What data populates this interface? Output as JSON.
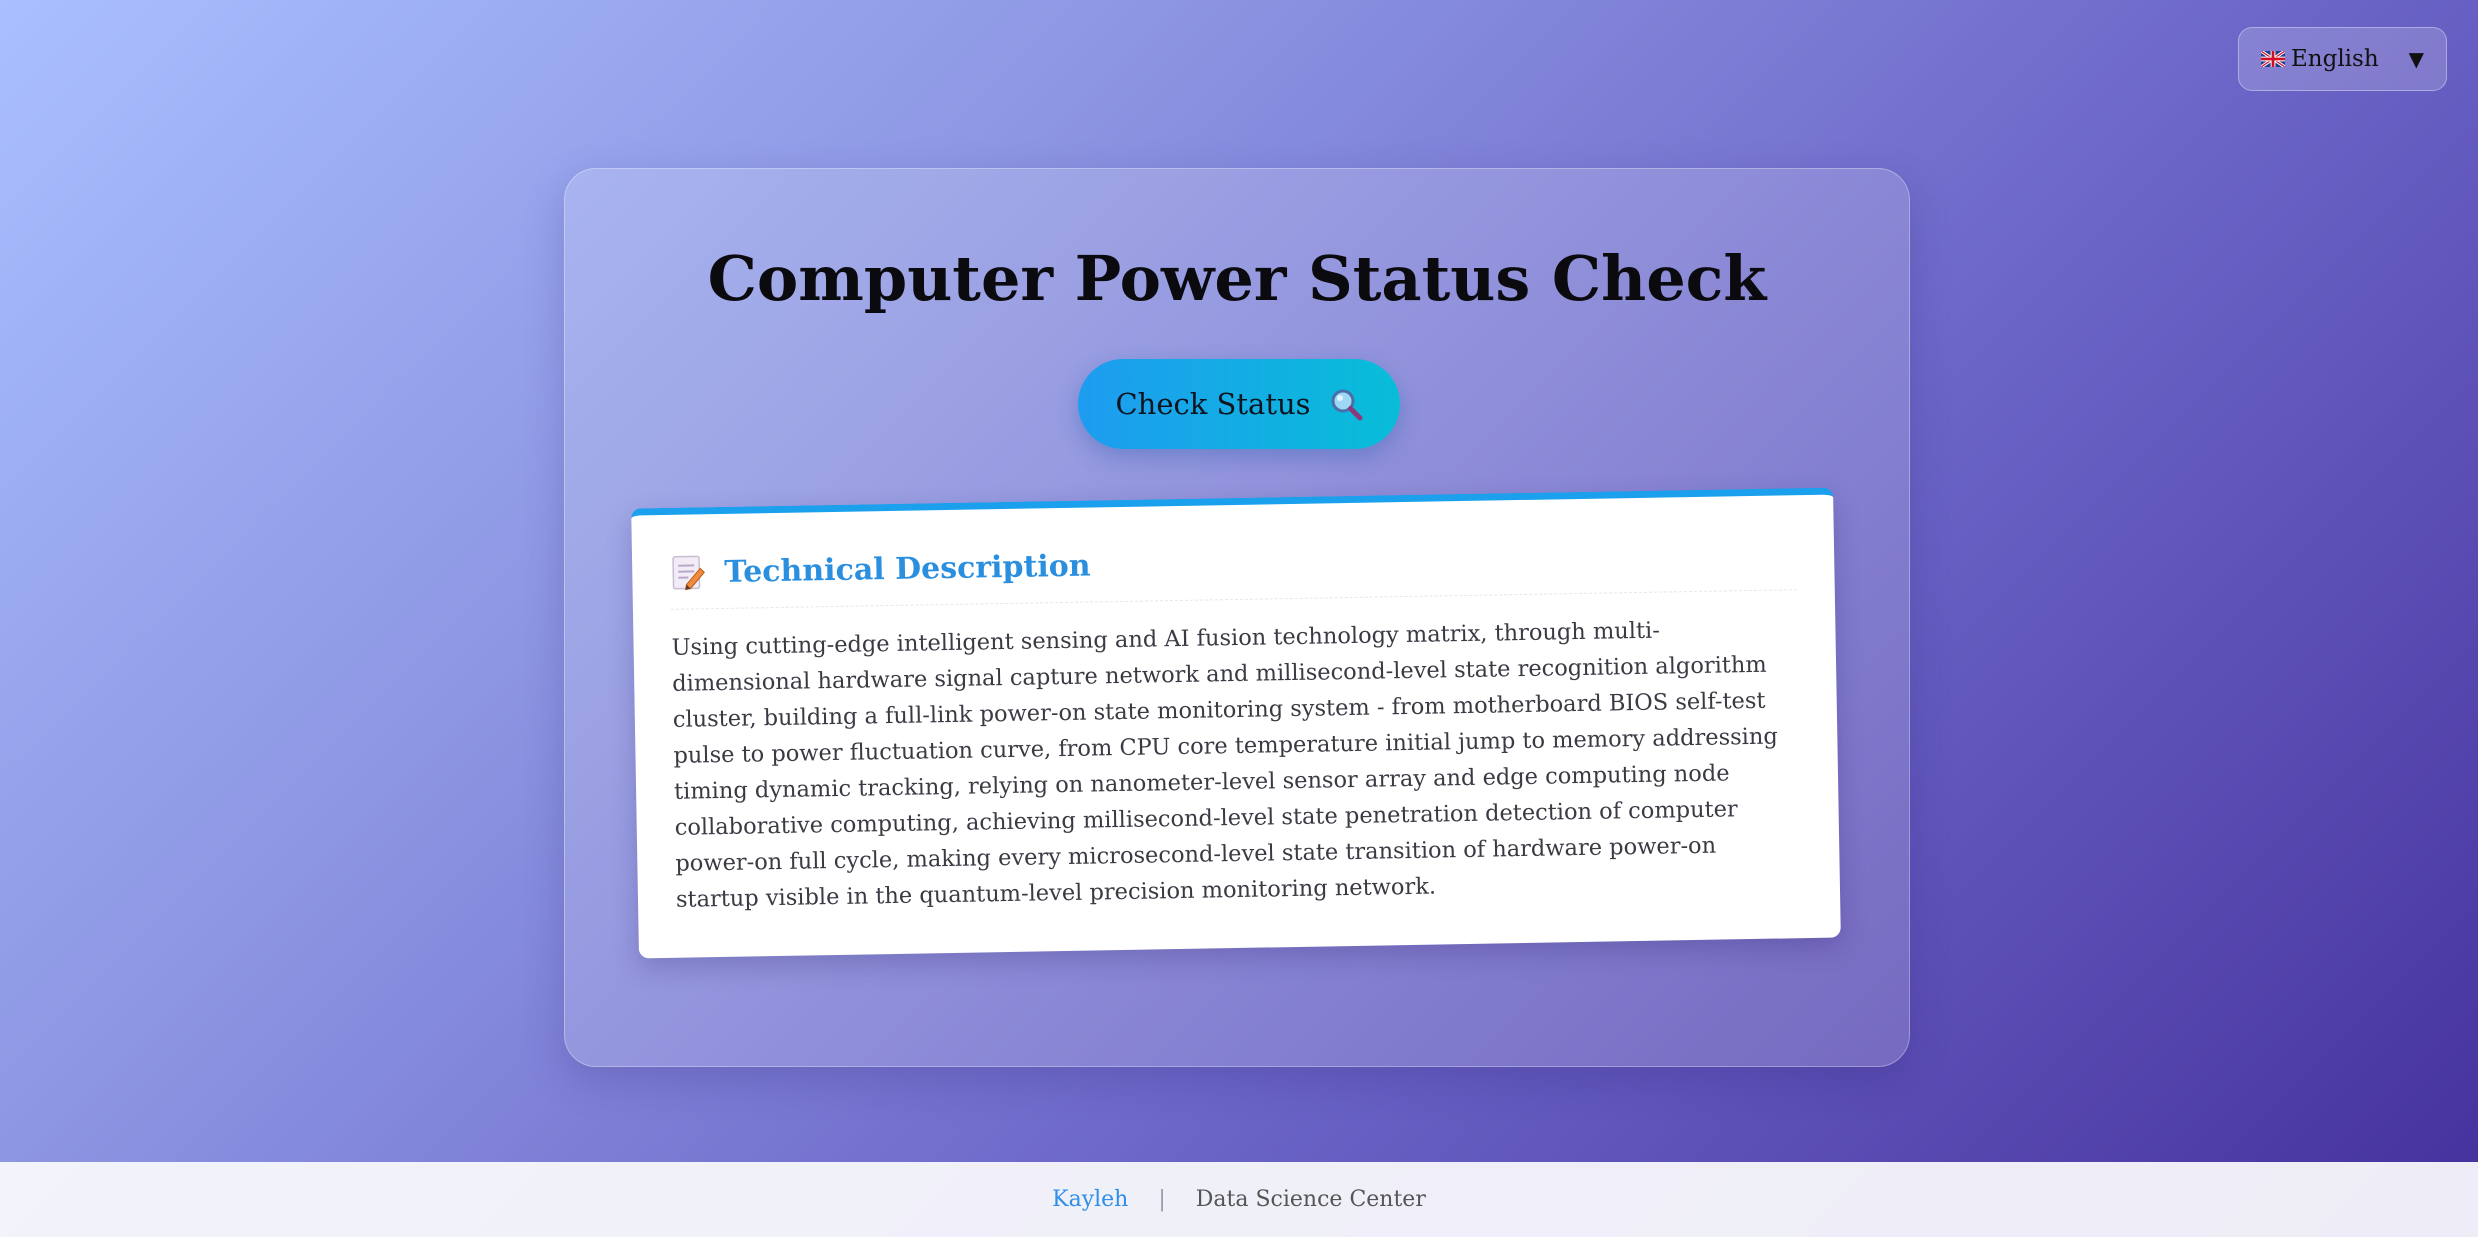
{
  "language_selector": {
    "label": "English",
    "flag": "uk-flag-icon",
    "chevron": "▼"
  },
  "main": {
    "title": "Computer Power Status Check",
    "check_button_label": "Check Status",
    "check_button_icon": "magnifying-glass-icon"
  },
  "description": {
    "icon": "memo-icon",
    "title": "Technical Description",
    "body": "Using cutting-edge intelligent sensing and AI fusion technology matrix, through multi-dimensional hardware signal capture network and millisecond-level state recognition algorithm cluster, building a full-link power-on state monitoring system - from motherboard BIOS self-test pulse to power fluctuation curve, from CPU core temperature initial jump to memory addressing timing dynamic tracking, relying on nanometer-level sensor array and edge computing node collaborative computing, achieving millisecond-level state penetration detection of computer power-on full cycle, making every microsecond-level state transition of hardware power-on startup visible in the quantum-level precision monitoring network."
  },
  "footer": {
    "author": "Kayleh",
    "separator": "|",
    "organization": "Data Science Center"
  },
  "colors": {
    "accent": "#1aa0ec",
    "title_blue": "#2b8fe0",
    "footer_link": "#2e8ee8",
    "button_gradient_start": "#1e9cf0",
    "button_gradient_end": "#08bdd8"
  }
}
